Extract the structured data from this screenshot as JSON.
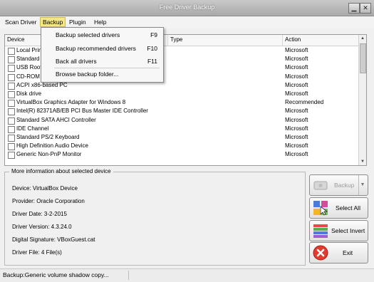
{
  "window": {
    "title": "Free Driver Backup"
  },
  "menubar": {
    "items": [
      "Scan Driver",
      "Backup",
      "Plugin",
      "Help"
    ]
  },
  "backup_menu": [
    {
      "label": "Backup selected drivers",
      "shortcut": "F9"
    },
    {
      "label": "Backup recommended drivers",
      "shortcut": "F10"
    },
    {
      "label": "Back all drivers",
      "shortcut": "F11"
    },
    {
      "label": "Browse backup folder...",
      "shortcut": ""
    }
  ],
  "table": {
    "headers": {
      "device": "Device",
      "type": "Type",
      "action": "Action"
    },
    "rows": [
      {
        "device": "Local Prin",
        "action": "Microsoft"
      },
      {
        "device": "Standard",
        "action": "Microsoft"
      },
      {
        "device": "USB Root",
        "action": "Microsoft"
      },
      {
        "device": "CD-ROM",
        "action": "Microsoft"
      },
      {
        "device": "ACPI x86-based PC",
        "action": "Microsoft"
      },
      {
        "device": "Disk drive",
        "action": "Microsoft"
      },
      {
        "device": "VirtualBox Graphics Adapter for Windows 8",
        "action": "Recommended"
      },
      {
        "device": "Intel(R) 82371AB/EB PCI Bus Master IDE Controller",
        "action": "Microsoft"
      },
      {
        "device": "Standard SATA AHCI Controller",
        "action": "Microsoft"
      },
      {
        "device": "IDE Channel",
        "action": "Microsoft"
      },
      {
        "device": "Standard PS/2 Keyboard",
        "action": "Microsoft"
      },
      {
        "device": "High Definition Audio Device",
        "action": "Microsoft"
      },
      {
        "device": "Generic Non-PnP Monitor",
        "action": "Microsoft"
      }
    ]
  },
  "info": {
    "title": "More information about selected device",
    "lines": [
      "Device:  VirtualBox Device",
      "Provider: Oracle Corporation",
      "Driver Date: 3-2-2015",
      "Driver Version: 4.3.24.0",
      "Digital Signature: VBoxGuest.cat",
      "Driver File: 4 File(s)"
    ]
  },
  "buttons": {
    "backup": "Backup",
    "select_all": "Select All",
    "select_invert": "Select Invert",
    "exit": "Exit"
  },
  "status": {
    "text": "Backup:Generic volume shadow copy..."
  }
}
